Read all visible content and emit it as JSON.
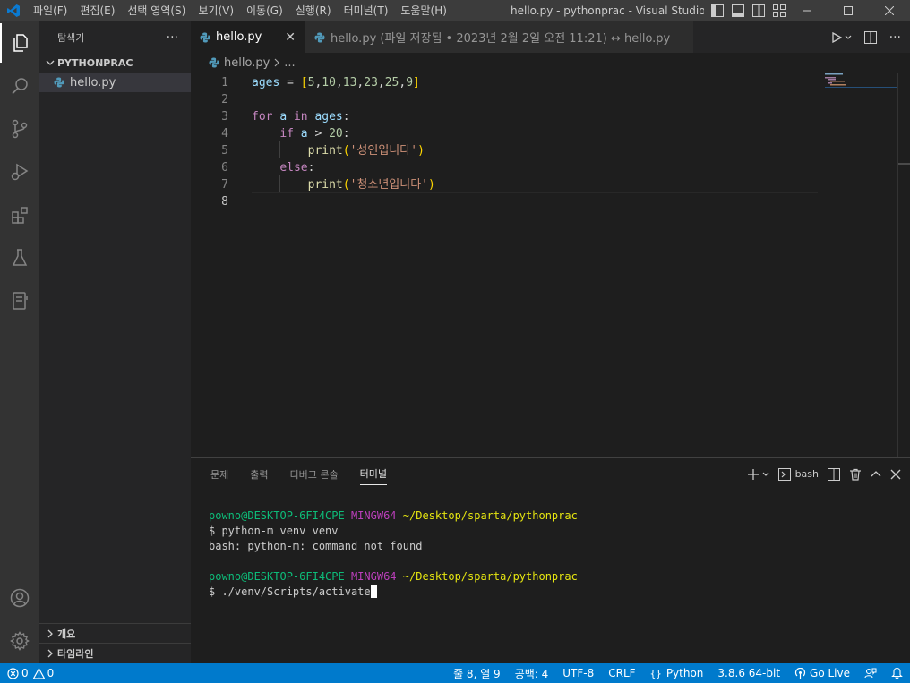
{
  "titlebar": {
    "menu": [
      "파일(F)",
      "편집(E)",
      "선택 영역(S)",
      "보기(V)",
      "이동(G)",
      "실행(R)",
      "터미널(T)",
      "도움말(H)"
    ],
    "window_title": "hello.py - pythonprac - Visual Studio C..."
  },
  "sidebar": {
    "title": "탐색기",
    "more": "···",
    "folder": "PYTHONPRAC",
    "files": [
      "hello.py"
    ],
    "outline": "개요",
    "timeline": "타임라인"
  },
  "tabs": [
    {
      "label": "hello.py",
      "active": true
    },
    {
      "label": "hello.py (파일 저장됨 • 2023년 2월 2일 오전 11:21) ↔ hello.py",
      "active": false
    }
  ],
  "breadcrumb": {
    "file": "hello.py",
    "rest": "..."
  },
  "editor": {
    "line_numbers": [
      "1",
      "2",
      "3",
      "4",
      "5",
      "6",
      "7",
      "8"
    ],
    "current_line": 8
  },
  "panel": {
    "tabs": [
      "문제",
      "출력",
      "디버그 콘솔",
      "터미널"
    ],
    "active_tab": "터미널",
    "shell": "bash",
    "terminal": {
      "user": "powno@DESKTOP-6FI4CPE",
      "host": "MINGW64",
      "path": "~/Desktop/sparta/pythonprac",
      "cmd1": "$ python-m venv venv",
      "out1": "bash: python-m: command not found",
      "cmd2": "$ ./venv/Scripts/activate"
    }
  },
  "statusbar": {
    "errors": "0",
    "warnings": "0",
    "position": "줄 8, 열 9",
    "spaces": "공백: 4",
    "encoding": "UTF-8",
    "eol": "CRLF",
    "language": "Python",
    "interpreter": "3.8.6 64-bit",
    "golive": "Go Live"
  },
  "colors": {
    "accent": "#007acc",
    "activity_bar": "#333333",
    "sidebar": "#252526",
    "editor": "#1e1e1e"
  }
}
